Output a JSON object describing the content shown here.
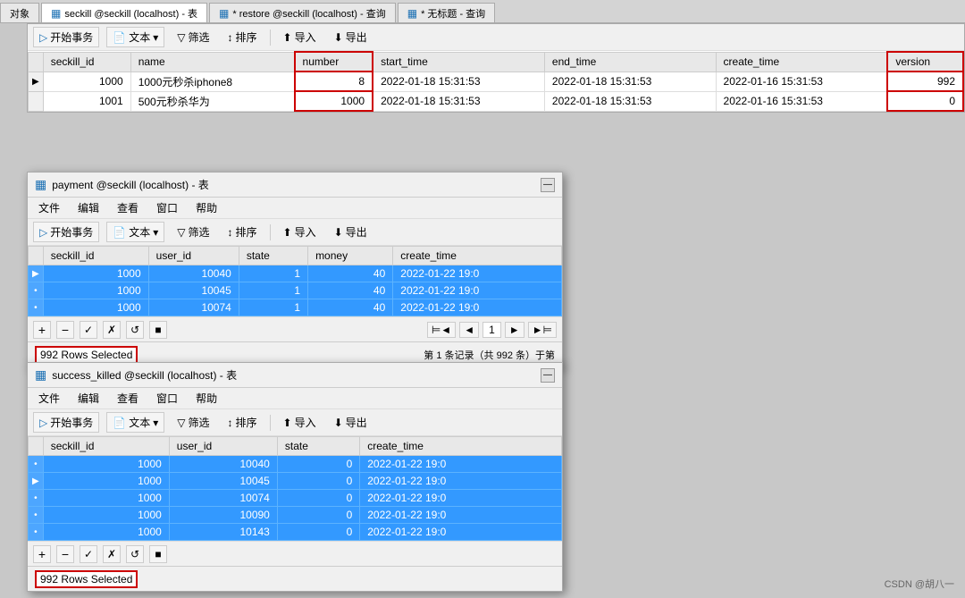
{
  "tabs": {
    "items": [
      {
        "label": "对象",
        "icon": "object"
      },
      {
        "label": "seckill @seckill (localhost) - 表",
        "icon": "table",
        "active": true
      },
      {
        "label": "* restore @seckill (localhost) - 查询",
        "icon": "query"
      },
      {
        "label": "* 无标题 - 查询",
        "icon": "query"
      }
    ]
  },
  "toolbar": {
    "begin_transaction": "开始事务",
    "text": "文本",
    "filter": "筛选",
    "sort": "排序",
    "import": "导入",
    "export": "导出"
  },
  "seckill_table": {
    "columns": [
      "seckill_id",
      "name",
      "number",
      "start_time",
      "end_time",
      "create_time",
      "version"
    ],
    "rows": [
      {
        "indicator": "▶",
        "seckill_id": "1000",
        "name": "1000元秒杀iphone8",
        "number": "8",
        "start_time": "2022-01-18 15:31:53",
        "end_time": "2022-01-18 15:31:53",
        "create_time": "2022-01-16 15:31:53",
        "version": "992"
      },
      {
        "indicator": "",
        "seckill_id": "1001",
        "name": "500元秒杀华为",
        "number": "1000",
        "start_time": "2022-01-18 15:31:53",
        "end_time": "2022-01-18 15:31:53",
        "create_time": "2022-01-16 15:31:53",
        "version": "0"
      }
    ]
  },
  "payment_window": {
    "title": "payment @seckill (localhost) - 表",
    "menu": [
      "文件",
      "编辑",
      "查看",
      "窗口",
      "帮助"
    ],
    "columns": [
      "seckill_id",
      "user_id",
      "state",
      "money",
      "create_time"
    ],
    "rows": [
      {
        "indicator": "▶",
        "seckill_id": "1000",
        "user_id": "10040",
        "state": "1",
        "money": "40",
        "create_time": "2022-01-22 19:0"
      },
      {
        "indicator": "•",
        "seckill_id": "1000",
        "user_id": "10045",
        "state": "1",
        "money": "40",
        "create_time": "2022-01-22 19:0"
      },
      {
        "indicator": "•",
        "seckill_id": "1000",
        "user_id": "10074",
        "state": "1",
        "money": "40",
        "create_time": "2022-01-22 19:0"
      }
    ],
    "status": "992 Rows Selected",
    "pagination": "第 1 条记录（共 992 条）于第",
    "page_nav": [
      "⊨◄",
      "◄",
      "1",
      "►",
      "►⊨"
    ]
  },
  "success_window": {
    "title": "success_killed @seckill (localhost) - 表",
    "menu": [
      "文件",
      "编辑",
      "查看",
      "窗口",
      "帮助"
    ],
    "columns": [
      "seckill_id",
      "user_id",
      "state",
      "create_time"
    ],
    "rows": [
      {
        "indicator": "•",
        "seckill_id": "1000",
        "user_id": "10040",
        "state": "0",
        "create_time": "2022-01-22 19:0"
      },
      {
        "indicator": "▶",
        "seckill_id": "1000",
        "user_id": "10045",
        "state": "0",
        "create_time": "2022-01-22 19:0"
      },
      {
        "indicator": "•",
        "seckill_id": "1000",
        "user_id": "10074",
        "state": "0",
        "create_time": "2022-01-22 19:0"
      },
      {
        "indicator": "•",
        "seckill_id": "1000",
        "user_id": "10090",
        "state": "0",
        "create_time": "2022-01-22 19:0"
      },
      {
        "indicator": "•",
        "seckill_id": "1000",
        "user_id": "10143",
        "state": "0",
        "create_time": "2022-01-22 19:0"
      }
    ],
    "status": "992 Rows Selected",
    "pagination": ""
  },
  "watermark": "CSDN @胡八一"
}
